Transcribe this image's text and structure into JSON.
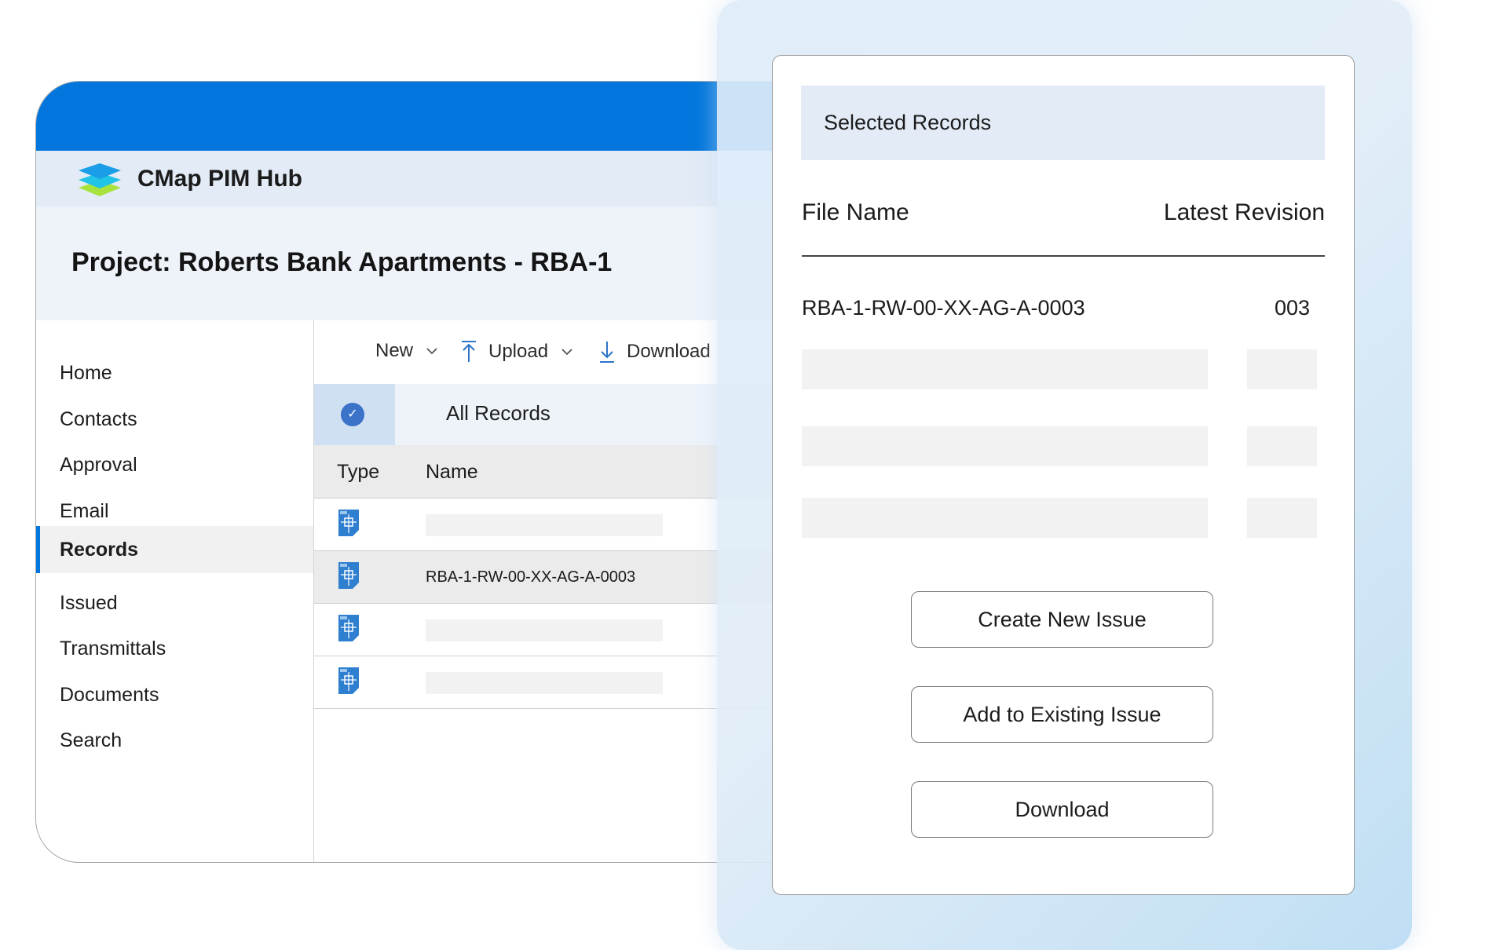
{
  "app": {
    "brand_name": "CMap PIM Hub",
    "project_title": "Project: Roberts Bank Apartments - RBA-1"
  },
  "sidebar": {
    "items": [
      {
        "label": "Home"
      },
      {
        "label": "Contacts"
      },
      {
        "label": "Approval"
      },
      {
        "label": "Email"
      },
      {
        "label": "Records",
        "active": true
      },
      {
        "label": "Issued"
      },
      {
        "label": "Transmittals"
      },
      {
        "label": "Documents"
      },
      {
        "label": "Search"
      }
    ]
  },
  "toolbar": {
    "new_label": "New",
    "upload_label": "Upload",
    "download_label": "Download"
  },
  "records_view": {
    "filter_label": "All Records",
    "columns": {
      "type": "Type",
      "name": "Name"
    },
    "rows": [
      {
        "type_icon": "dwg-file-icon",
        "name": ""
      },
      {
        "type_icon": "dwg-file-icon",
        "name": "RBA-1-RW-00-XX-AG-A-0003",
        "selected": true
      },
      {
        "type_icon": "dwg-file-icon",
        "name": ""
      },
      {
        "type_icon": "dwg-file-icon",
        "name": ""
      }
    ]
  },
  "selected_panel": {
    "title": "Selected Records",
    "columns": {
      "file_name": "File Name",
      "latest_revision": "Latest Revision"
    },
    "records": [
      {
        "file_name": "RBA-1-RW-00-XX-AG-A-0003",
        "revision": "003"
      }
    ],
    "buttons": {
      "create_new_issue": "Create New Issue",
      "add_to_existing_issue": "Add to Existing Issue",
      "download": "Download"
    }
  },
  "colors": {
    "accent": "#0276dc",
    "header_tint": "#e2ebf6",
    "check": "#3b73c9"
  }
}
